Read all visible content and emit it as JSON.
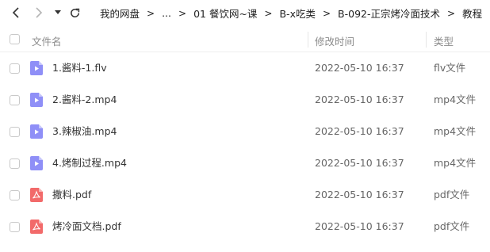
{
  "toolbar": {
    "back_icon": "chevron-left-icon",
    "forward_icon": "chevron-right-icon",
    "history_icon": "caret-down-icon",
    "refresh_icon": "refresh-icon"
  },
  "breadcrumb": [
    {
      "label": "我的网盘"
    },
    {
      "label": "..."
    },
    {
      "label": "01 餐饮网~课"
    },
    {
      "label": "B-x吃类"
    },
    {
      "label": "B-092-正宗烤冷面技术"
    },
    {
      "label": "教程"
    }
  ],
  "breadcrumb_separator": ">",
  "columns": {
    "name": "文件名",
    "modified": "修改时间",
    "type": "类型"
  },
  "files": [
    {
      "name": "1.酱料-1.flv",
      "modified": "2022-05-10 16:37",
      "type": "flv文件",
      "icon": "video-file-icon"
    },
    {
      "name": "2.酱料-2.mp4",
      "modified": "2022-05-10 16:37",
      "type": "mp4文件",
      "icon": "video-file-icon"
    },
    {
      "name": "3.辣椒油.mp4",
      "modified": "2022-05-10 16:37",
      "type": "mp4文件",
      "icon": "video-file-icon"
    },
    {
      "name": "4.烤制过程.mp4",
      "modified": "2022-05-10 16:37",
      "type": "mp4文件",
      "icon": "video-file-icon"
    },
    {
      "name": "撒料.pdf",
      "modified": "2022-05-10 16:37",
      "type": "pdf文件",
      "icon": "pdf-file-icon"
    },
    {
      "name": "烤冷面文档.pdf",
      "modified": "2022-05-10 16:37",
      "type": "pdf文件",
      "icon": "pdf-file-icon"
    }
  ],
  "colors": {
    "video_icon": "#8f8ff7",
    "pdf_icon": "#f26a6a",
    "header_text": "#8a8a8a"
  }
}
